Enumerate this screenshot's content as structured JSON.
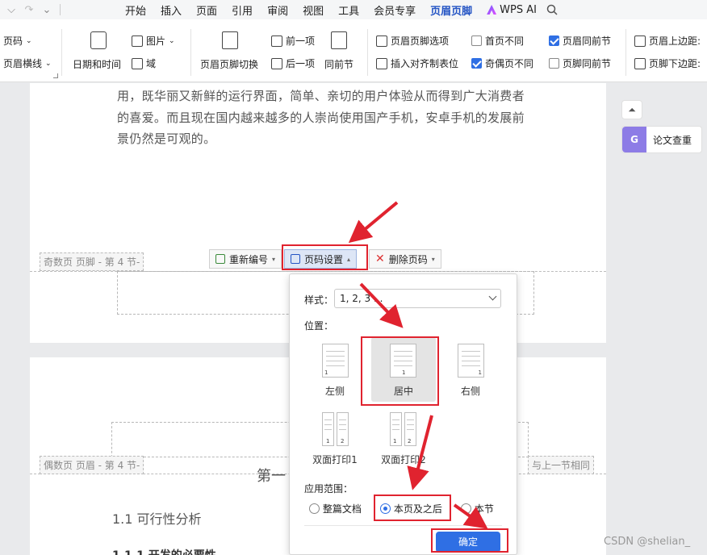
{
  "menubar": {
    "tabs": [
      "开始",
      "插入",
      "页面",
      "引用",
      "审阅",
      "视图",
      "工具",
      "会员专享",
      "页眉页脚",
      "WPS AI"
    ],
    "active_tab": "页眉页脚"
  },
  "ribbon": {
    "page_number": "页码",
    "header_line": "页眉横线",
    "date_time": "日期和时间",
    "picture": "图片",
    "field": "域",
    "switch": "页眉页脚切换",
    "prev": "前一项",
    "next": "后一项",
    "same_section": "同前节",
    "options": "页眉页脚选项",
    "insert_tab": "插入对齐制表位",
    "first_page_diff": "首页不同",
    "odd_even_diff": "奇偶页不同",
    "header_same_prev": "页眉同前节",
    "footer_same_prev": "页脚同前节",
    "header_top": "页眉上边距:",
    "footer_bottom": "页脚下边距:"
  },
  "checkboxes": {
    "first_page_diff": false,
    "odd_even_diff": true,
    "header_same_prev": true,
    "footer_same_prev": false
  },
  "document": {
    "lines": [
      "用，既华丽又新鲜的运行界面，简单、亲切的用户体验从而得到广大消费者",
      "的喜爱。而且现在国内越来越多的人崇尚使用国产手机，安卓手机的发展前",
      "景仍然是可观的。"
    ],
    "odd_footer_label": "奇数页 页脚  - 第 4 节-",
    "even_header_label": "偶数页 页眉  - 第 4 节-",
    "same_as_prev_label": "与上一节相同",
    "chapter_partial": "第一",
    "section_heading": "1.1  可行性分析",
    "subsection_partial": "1.1.1  开发的必要性"
  },
  "page_number_toolbar": {
    "renumber": "重新编号",
    "settings": "页码设置",
    "delete": "删除页码"
  },
  "dialog": {
    "style_label": "样式：",
    "style_value": "1, 2, 3 ...",
    "position_label": "位置：",
    "positions": [
      "左侧",
      "居中",
      "右侧",
      "双面打印1",
      "双面打印2"
    ],
    "selected_position": "居中",
    "scope_label": "应用范围：",
    "scope_options": [
      "整篇文档",
      "本页及之后",
      "本节"
    ],
    "selected_scope": "本页及之后",
    "ok": "确定"
  },
  "sidebar": {
    "paper_check": "论文查重"
  },
  "watermark": "CSDN @shelian_",
  "icons": [
    "undo-icon",
    "redo-icon",
    "dropdown-icon",
    "wps-ai-logo-icon",
    "search-icon",
    "calendar-clock-icon",
    "picture-icon",
    "field-icon",
    "header-footer-switch-icon",
    "prev-item-icon",
    "next-item-icon",
    "same-section-icon",
    "options-icon",
    "tab-stop-icon",
    "header-margin-icon",
    "footer-margin-icon",
    "renumber-icon",
    "page-number-settings-icon",
    "delete-icon",
    "collapse-icon",
    "paper-check-icon"
  ],
  "colors": {
    "accent": "#2454c4",
    "primary_button": "#2f6fe4",
    "highlight_red": "#e0232f"
  }
}
